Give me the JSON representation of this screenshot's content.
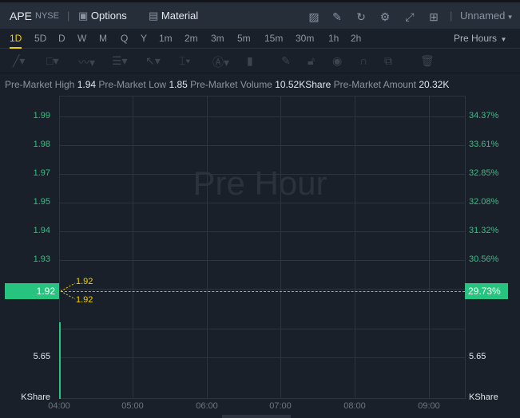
{
  "header": {
    "symbol": "APE",
    "exchange": "NYSE",
    "options_label": "Options",
    "material_label": "Material",
    "layout_label": "Unnamed"
  },
  "periods": [
    "1D",
    "5D",
    "D",
    "W",
    "M",
    "Q",
    "Y",
    "1m",
    "2m",
    "3m",
    "5m",
    "15m",
    "30m",
    "1h",
    "2h"
  ],
  "active_period": "1D",
  "session_select": "Pre Hours",
  "info": {
    "high_label": "Pre-Market High",
    "high": "1.94",
    "low_label": "Pre-Market Low",
    "low": "1.85",
    "volume_label": "Pre-Market Volume",
    "volume": "10.52KShare",
    "amount_label": "Pre-Market Amount",
    "amount": "20.32K"
  },
  "chart": {
    "watermark": "Pre Hour",
    "left_axis": [
      "1.99",
      "1.98",
      "1.97",
      "1.95",
      "1.94",
      "1.93"
    ],
    "right_axis": [
      "34.37%",
      "33.61%",
      "32.85%",
      "32.08%",
      "31.32%",
      "30.56%"
    ],
    "current_price": "1.92",
    "current_pct": "29.73%",
    "marker_high": "1.92",
    "marker_low": "1.92",
    "volume_tick": "5.65",
    "volume_unit": "KShare",
    "x_ticks": [
      "04:00",
      "05:00",
      "06:00",
      "07:00",
      "08:00",
      "09:00"
    ],
    "colors": {
      "up": "#27c47f",
      "marker": "#f0d000"
    }
  }
}
